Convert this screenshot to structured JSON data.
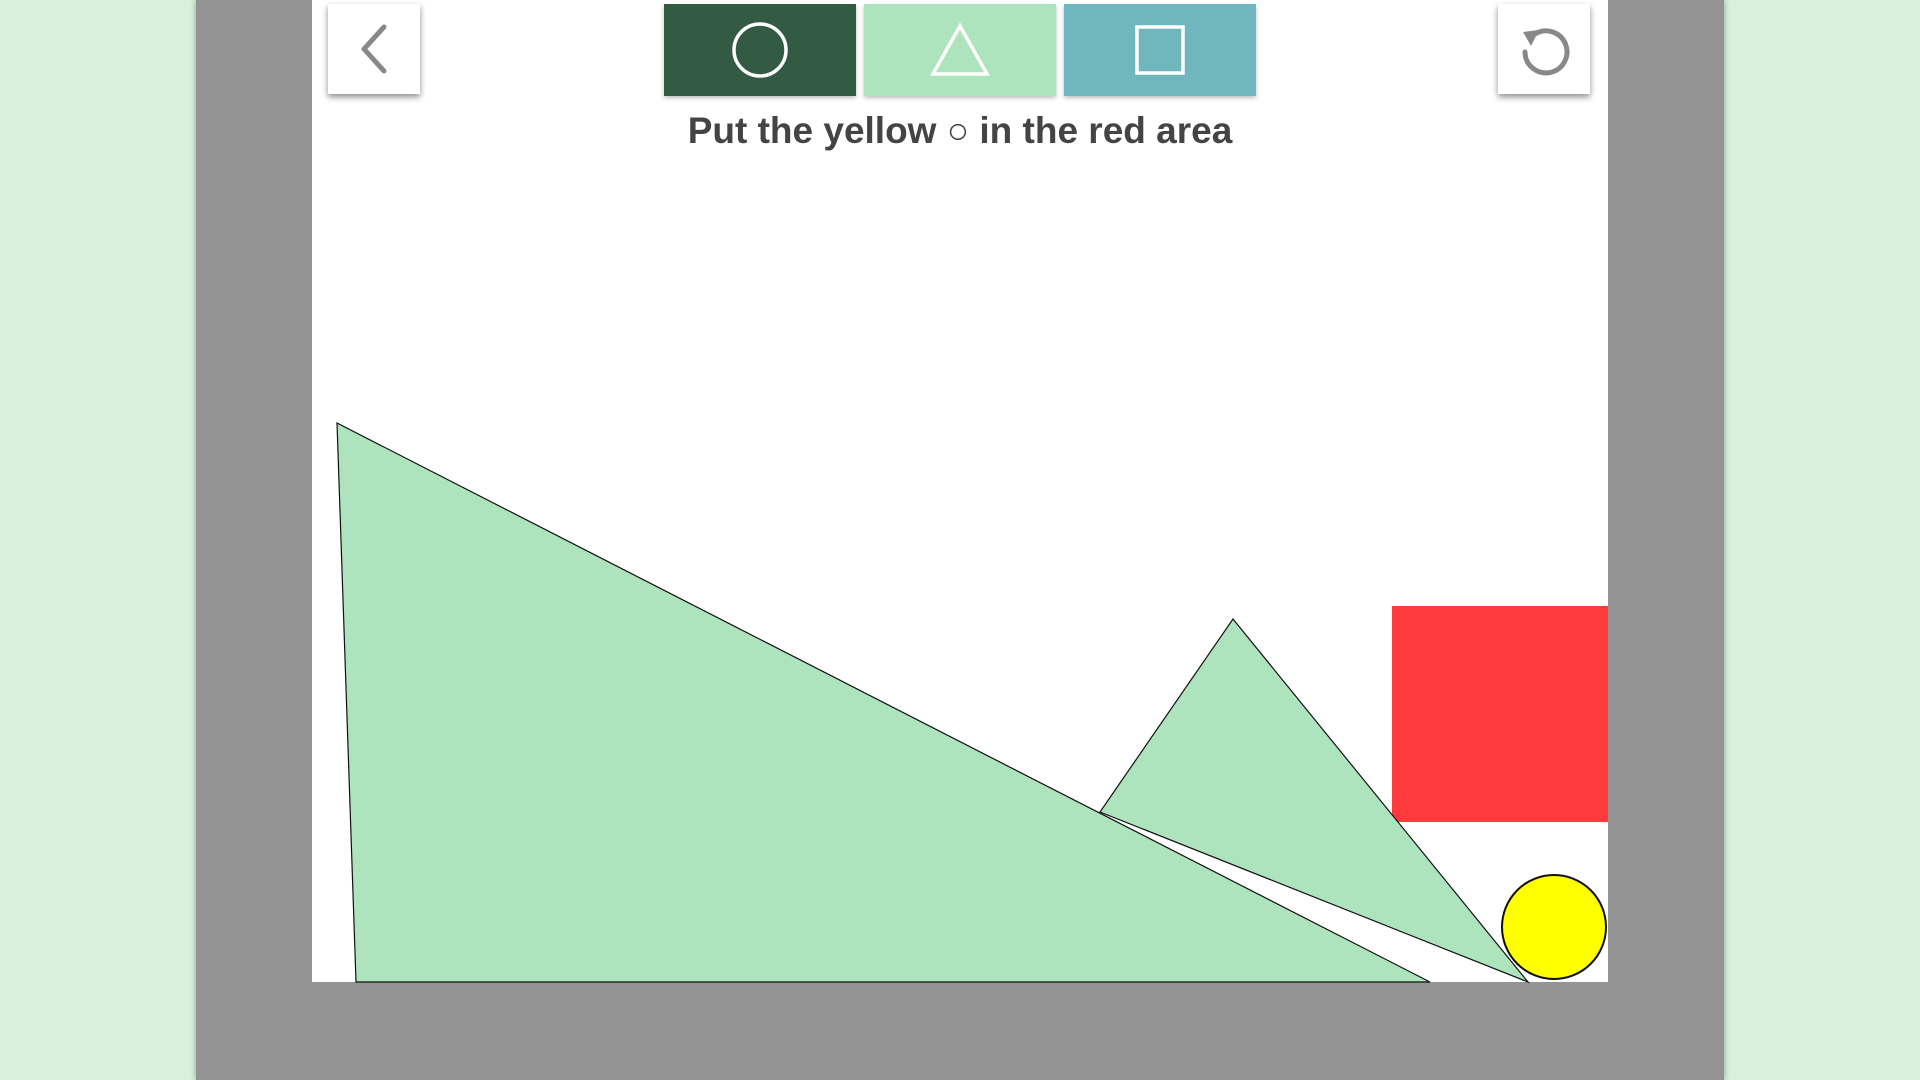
{
  "toolbar": {
    "back_icon": "chevron-left-icon",
    "reset_icon": "reset-icon",
    "tools": [
      {
        "name": "circle",
        "icon": "circle-icon",
        "color": "#335b44"
      },
      {
        "name": "triangle",
        "icon": "triangle-icon",
        "color": "#aee4bd"
      },
      {
        "name": "square",
        "icon": "square-icon",
        "color": "#6fb7bd"
      }
    ]
  },
  "instruction": "Put the yellow ○ in the red area",
  "colors": {
    "background": "#d8f0dc",
    "frame": "#949494",
    "stage": "#ffffff",
    "shape_fill": "#aee4bd",
    "goal_area": "#ff3b3b",
    "ball": "#ffff00"
  }
}
